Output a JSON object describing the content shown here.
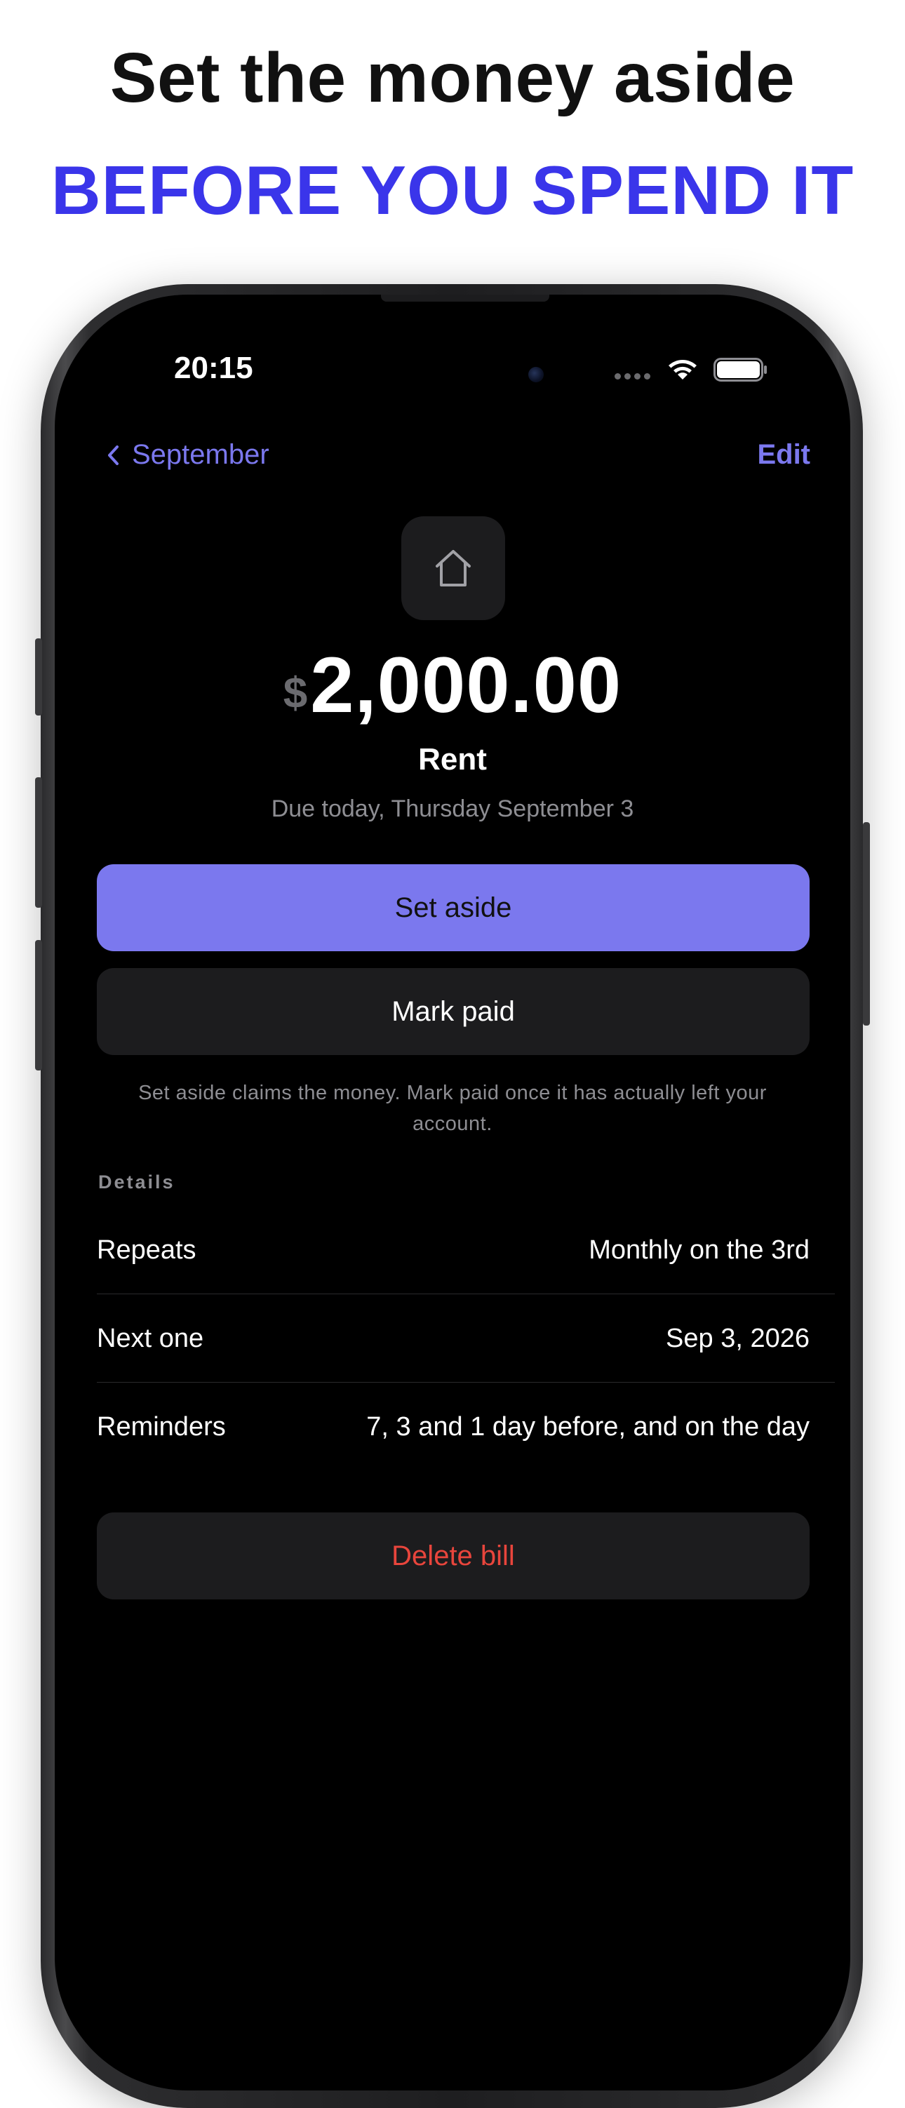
{
  "headline": {
    "line1": "Set the money aside",
    "line2": "BEFORE YOU SPEND IT"
  },
  "status_bar": {
    "time": "20:15"
  },
  "nav": {
    "back_label": "September",
    "edit_label": "Edit"
  },
  "bill": {
    "icon": "house-icon",
    "currency_symbol": "$",
    "amount": "2,000.00",
    "name": "Rent",
    "due": "Due today, Thursday September 3"
  },
  "actions": {
    "set_aside_label": "Set aside",
    "mark_paid_label": "Mark paid",
    "helper": "Set aside claims the money. Mark paid once it has actually left your account.",
    "delete_label": "Delete bill"
  },
  "details": {
    "section_label": "Details",
    "rows": [
      {
        "label": "Repeats",
        "value": "Monthly on the 3rd"
      },
      {
        "label": "Next one",
        "value": "Sep 3, 2026"
      },
      {
        "label": "Reminders",
        "value": "7, 3 and 1 day before, and on the day"
      }
    ]
  },
  "colors": {
    "accent": "#7b78ee",
    "headline_accent": "#3a35ea",
    "danger": "#e8453c",
    "background": "#000000",
    "card": "#1c1c1e"
  }
}
